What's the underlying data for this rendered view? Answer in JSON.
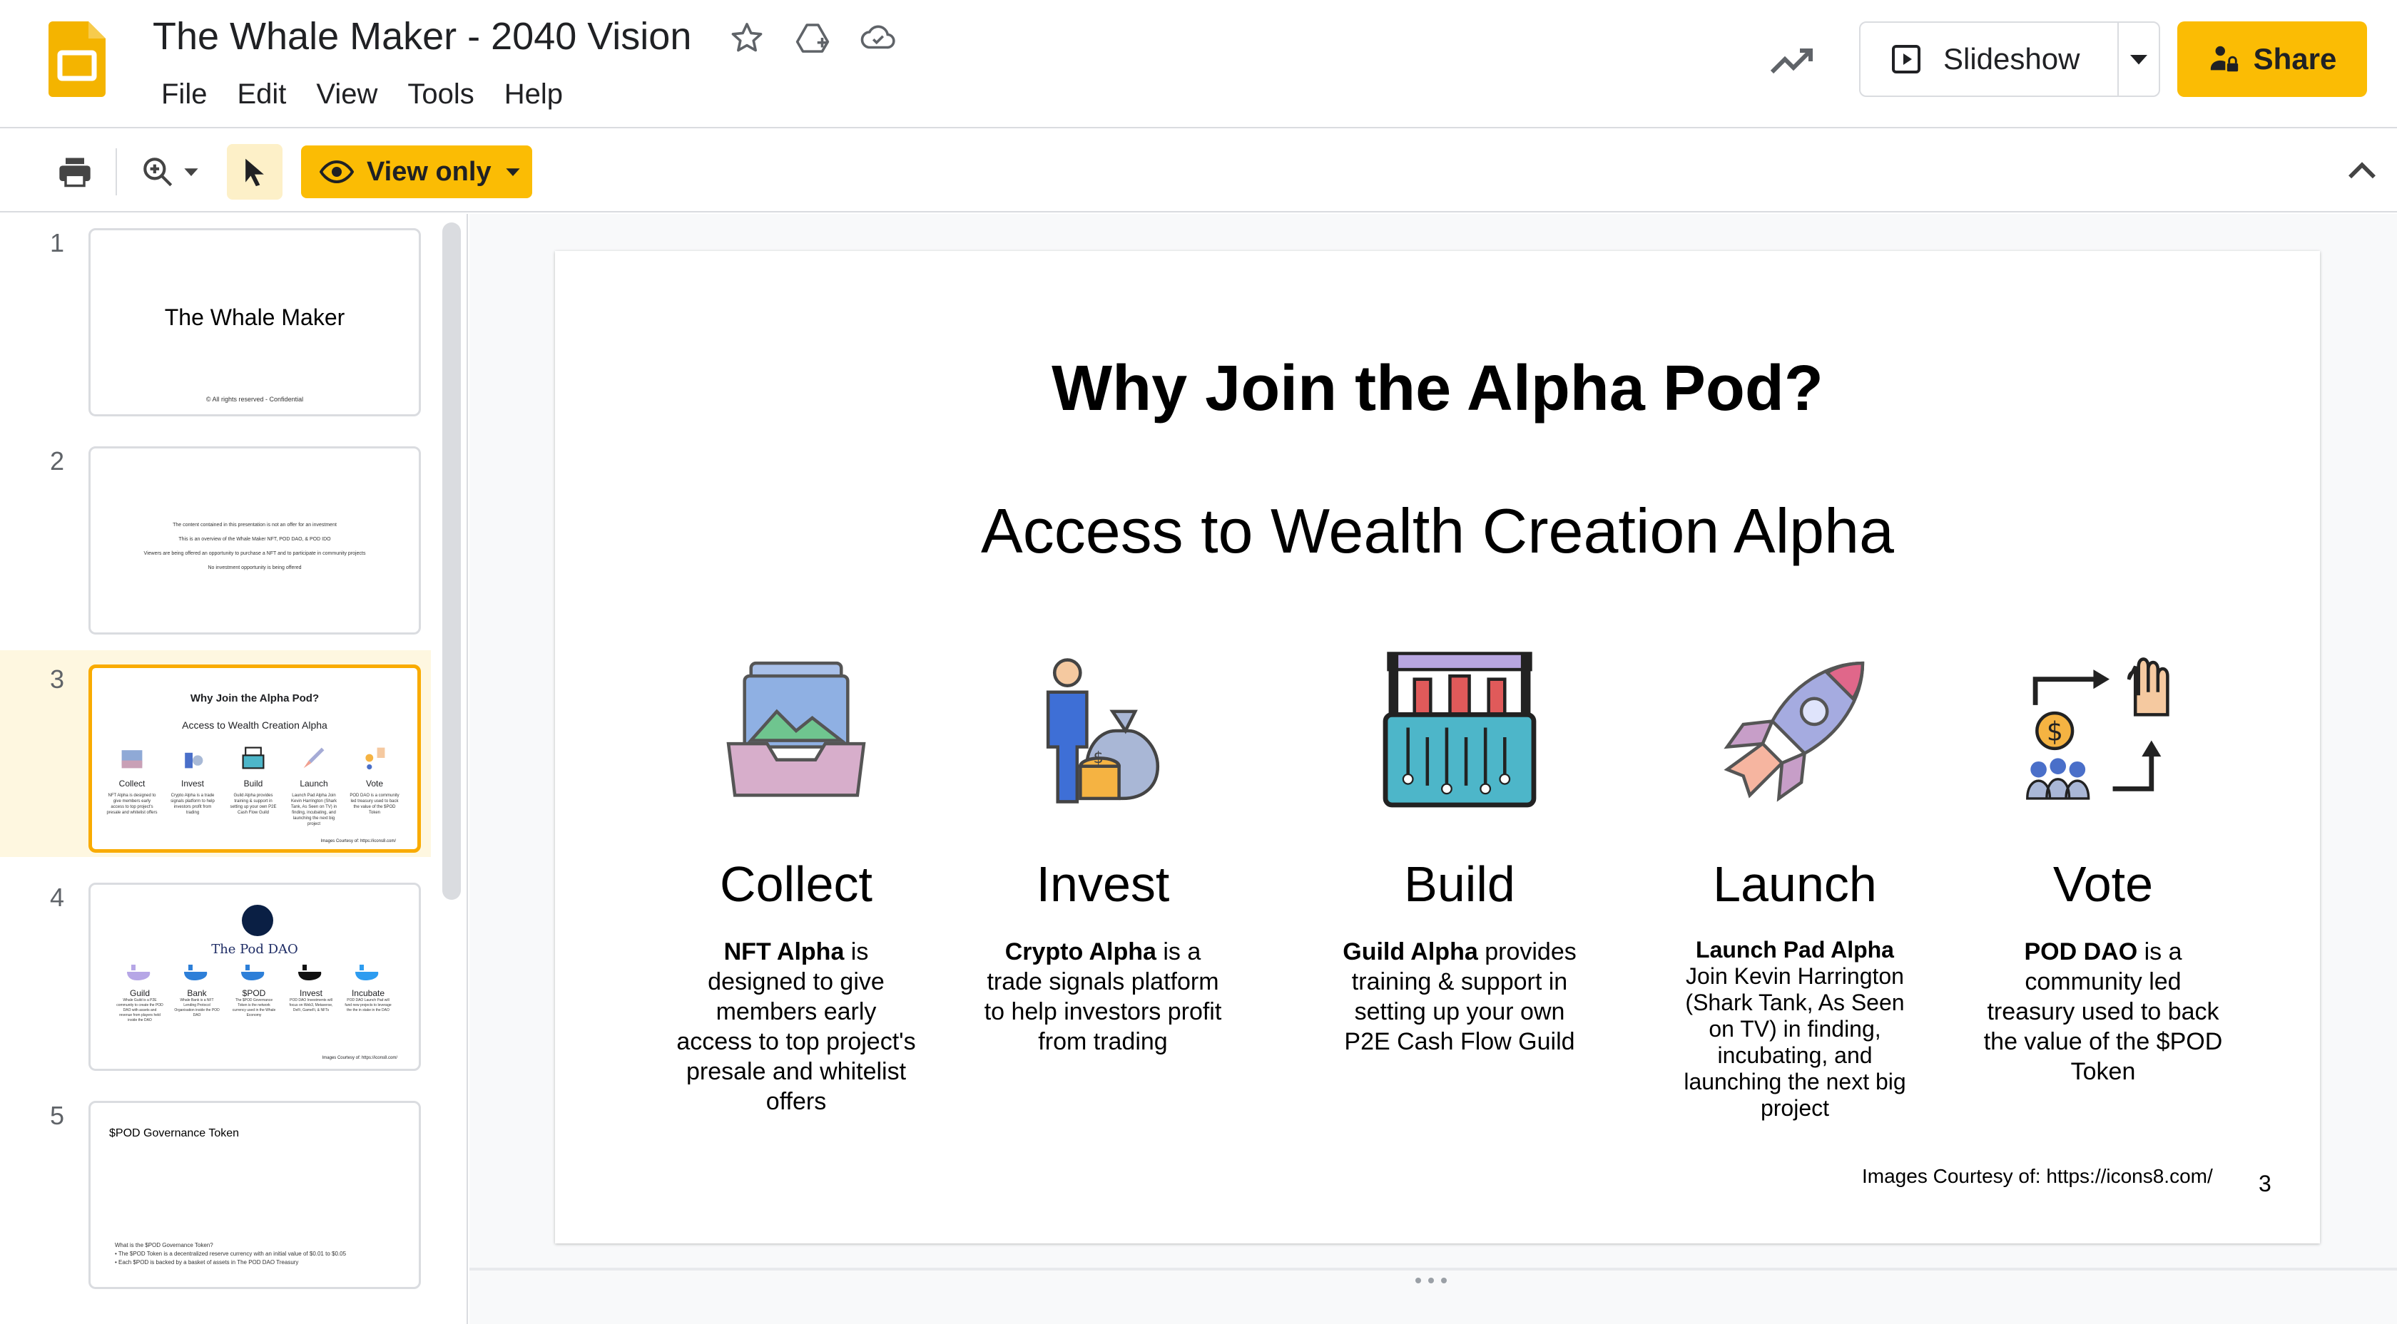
{
  "header": {
    "doc_title": "The Whale Maker - 2040 Vision",
    "menu": [
      "File",
      "Edit",
      "View",
      "Tools",
      "Help"
    ],
    "slideshow_label": "Slideshow",
    "share_label": "Share",
    "accent_color": "#fbbc04"
  },
  "toolbar": {
    "view_only_label": "View only"
  },
  "filmstrip": {
    "selected": 3,
    "slides": [
      {
        "num": "1",
        "title": "The Whale Maker",
        "footer": "© All rights reserved - Confidential"
      },
      {
        "num": "2",
        "lines": [
          "The content contained in this presentation is not an offer for an investment",
          "This is an overview of the Whale Maker NFT, POD DAO, & POD IDO",
          "Viewers are being offered an opportunity to purchase a NFT and to participate in community projects",
          "No investment opportunity is being offered"
        ]
      },
      {
        "num": "3",
        "title": "Why Join the Alpha Pod?",
        "subtitle": "Access to Wealth Creation Alpha",
        "cols": [
          {
            "label": "Collect",
            "text": "NFT Alpha is designed to give members early access to top project's presale and whitelist offers"
          },
          {
            "label": "Invest",
            "text": "Crypto Alpha is a trade signals platform to help investors profit from trading"
          },
          {
            "label": "Build",
            "text": "Guild Alpha provides training & support in setting up your own P2E Cash Flow Guild"
          },
          {
            "label": "Launch",
            "text": "Launch Pad Alpha Join Kevin Harrington (Shark Tank, As Seen on TV) in finding, incubating, and launching the next big project"
          },
          {
            "label": "Vote",
            "text": "POD DAO is a community led treasury used to back the value of the $POD Token"
          }
        ],
        "credit": "Images Courtesy of: https://icons8.com/"
      },
      {
        "num": "4",
        "title": "The Pod DAO",
        "cols": [
          {
            "label": "Guild",
            "text": "Whale Guild is a P2E community to create the POD DAO with assets and revenue from players held inside the DAO"
          },
          {
            "label": "Bank",
            "text": "Whale Bank is a NFT Lending Protocol Organisation inside the POD DAO"
          },
          {
            "label": "$POD",
            "text": "The $POD Governance Token is the network currency used in the Whale Economy"
          },
          {
            "label": "Invest",
            "text": "POD DAO Investments will focus on Web3, Metaverse, DeFi, GameFi, & NFTs"
          },
          {
            "label": "Incubate",
            "text": "POD DAO Launch Pad will fund new projects to leverage the the in stake in the DAO"
          }
        ],
        "credit": "Images Courtesy of: https://icons8.com/"
      },
      {
        "num": "5",
        "title": "$POD Governance Token",
        "lines": [
          "What is the $POD Governance Token?",
          "• The $POD Token is a decentralized reserve currency with an initial value of $0.01 to $0.05",
          "• Each $POD is backed by a basket of assets in The POD DAO Treasury"
        ]
      }
    ]
  },
  "slide": {
    "title": "Why Join the Alpha Pod?",
    "subtitle": "Access to Wealth Creation Alpha",
    "columns": [
      {
        "name": "Collect",
        "bold": "NFT Alpha",
        "rest": " is designed to give members early access to top project's presale and whitelist offers"
      },
      {
        "name": "Invest",
        "bold": "Crypto Alpha",
        "rest": " is a trade signals platform to help investors profit from trading"
      },
      {
        "name": "Build",
        "bold": "Guild Alpha",
        "rest": " provides training & support in setting up your own P2E Cash Flow Guild"
      },
      {
        "name": "Launch",
        "bold": "Launch Pad Alpha",
        "rest": " Join Kevin Harrington (Shark Tank, As Seen on TV) in finding, incubating, and launching the next big project"
      },
      {
        "name": "Vote",
        "bold": "POD DAO",
        "rest": " is a community led treasury used to back the value of the $POD Token"
      }
    ],
    "credits": "Images Courtesy of: https://icons8.com/",
    "page_number": "3"
  }
}
